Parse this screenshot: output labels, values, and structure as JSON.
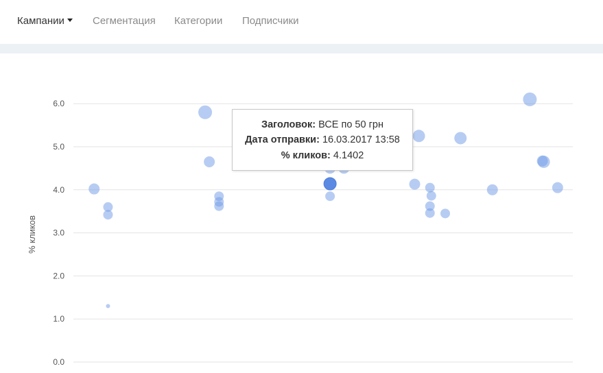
{
  "nav": {
    "items": [
      {
        "label": "Кампании",
        "active": true,
        "dropdown": true
      },
      {
        "label": "Сегментация",
        "active": false
      },
      {
        "label": "Категории",
        "active": false
      },
      {
        "label": "Подписчики",
        "active": false
      }
    ]
  },
  "chart_data": {
    "type": "scatter",
    "ylabel": "% кликов",
    "ylim": [
      0,
      6.4
    ],
    "yticks": [
      "0.0",
      "1.0",
      "2.0",
      "3.0",
      "4.0",
      "5.0",
      "6.0"
    ],
    "grid": true,
    "point_color": "#6f9ae6",
    "highlight_color": "#4a7ddf",
    "points": [
      {
        "x": 1,
        "y": 4.02,
        "size": 8
      },
      {
        "x": 2,
        "y": 3.6,
        "size": 7
      },
      {
        "x": 2,
        "y": 3.42,
        "size": 7
      },
      {
        "x": 2,
        "y": 1.3,
        "size": 3
      },
      {
        "x": 9,
        "y": 5.8,
        "size": 10
      },
      {
        "x": 9.3,
        "y": 4.65,
        "size": 8
      },
      {
        "x": 10,
        "y": 3.85,
        "size": 7
      },
      {
        "x": 10,
        "y": 3.72,
        "size": 7
      },
      {
        "x": 10,
        "y": 3.62,
        "size": 7
      },
      {
        "x": 18,
        "y": 4.5,
        "size": 8
      },
      {
        "x": 18,
        "y": 4.14,
        "size": 9,
        "highlight": true
      },
      {
        "x": 18,
        "y": 3.85,
        "size": 7
      },
      {
        "x": 19,
        "y": 4.5,
        "size": 8
      },
      {
        "x": 24.4,
        "y": 5.25,
        "size": 9
      },
      {
        "x": 24.1,
        "y": 4.13,
        "size": 8
      },
      {
        "x": 25.2,
        "y": 4.05,
        "size": 7
      },
      {
        "x": 25.3,
        "y": 3.86,
        "size": 7
      },
      {
        "x": 25.2,
        "y": 3.62,
        "size": 7
      },
      {
        "x": 25.2,
        "y": 3.46,
        "size": 7
      },
      {
        "x": 26.3,
        "y": 3.45,
        "size": 7
      },
      {
        "x": 27.4,
        "y": 5.2,
        "size": 9
      },
      {
        "x": 29.7,
        "y": 4.0,
        "size": 8
      },
      {
        "x": 32.4,
        "y": 6.1,
        "size": 10
      },
      {
        "x": 33.3,
        "y": 4.67,
        "size": 8
      },
      {
        "x": 33.4,
        "y": 4.65,
        "size": 9
      },
      {
        "x": 34.4,
        "y": 4.05,
        "size": 8
      }
    ],
    "xlim": [
      0,
      35
    ]
  },
  "tooltip": {
    "title_label": "Заголовок",
    "title_value": "ВСЕ по 50 грн",
    "date_label": "Дата отправки",
    "date_value": "16.03.2017 13:58",
    "clicks_label": "% кликов",
    "clicks_value": "4.1402"
  }
}
